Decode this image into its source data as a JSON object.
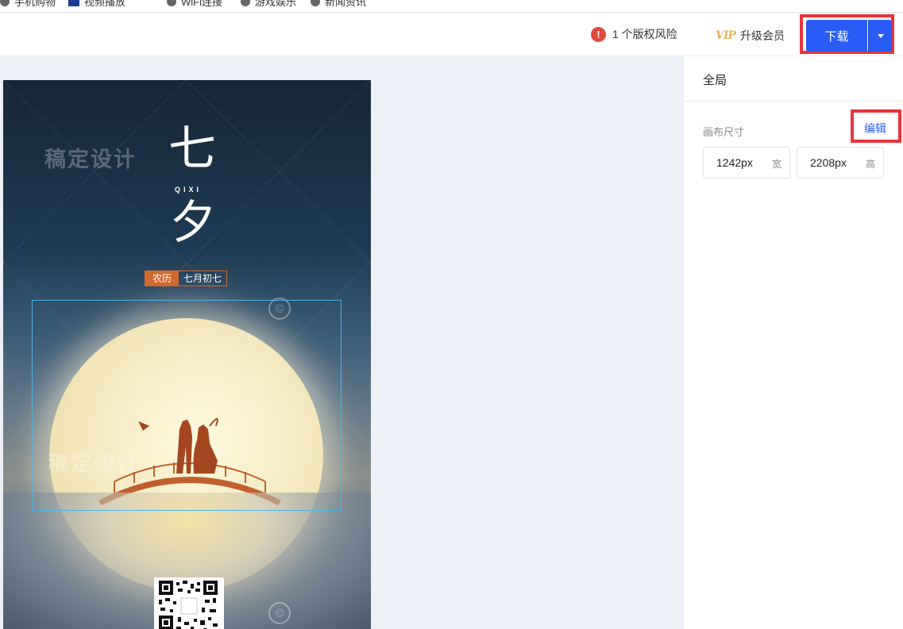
{
  "bookmarks": [
    "手机购物",
    "视频播放",
    "WiFi连接",
    "游戏娱乐",
    "新闻资讯"
  ],
  "toolbar": {
    "risk_icon": "!",
    "risk_text": "1 个版权风险",
    "vip_icon": "VIP",
    "vip_text": "升级会员",
    "download_label": "下载",
    "colors": {
      "primary": "#2a5cf7",
      "highlight": "#e8343a",
      "risk": "#e0493b"
    }
  },
  "poster": {
    "watermark": "稿定设计",
    "title_char_1": "七",
    "subtitle": "QIXI",
    "title_char_2": "夕",
    "lunar_label": "农历",
    "lunar_date": "七月初七",
    "copyright_symbol": "©"
  },
  "panel": {
    "title": "全局",
    "canvas_size_label": "画布尺寸",
    "edit_label": "编辑",
    "width_value": "1242px",
    "width_unit": "宽",
    "height_value": "2208px",
    "height_unit": "高"
  }
}
